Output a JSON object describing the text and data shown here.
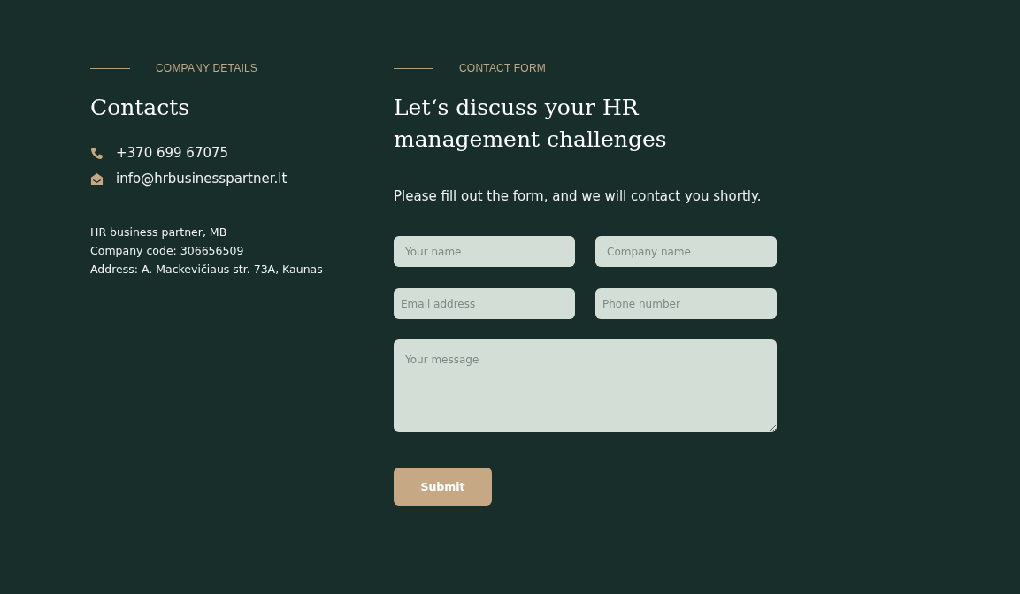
{
  "company": {
    "eyebrow": "COMPANY DETAILS",
    "title": "Contacts",
    "contacts": [
      {
        "kind": "phone",
        "text": "+370 699 67075"
      },
      {
        "kind": "email",
        "text": "info@hrbusinesspartner.lt"
      }
    ],
    "details": [
      "HR business partner, MB",
      "Company code: 306656509",
      "Address: A. Mackevičiaus str. 73A, Kaunas"
    ]
  },
  "form": {
    "eyebrow": "CONTACT FORM",
    "title": "Let‘s discuss your HR management challenges",
    "intro": "Please fill out the form, and we will contact you shortly.",
    "fields": [
      {
        "placeholder": "Your name"
      },
      {
        "placeholder": "Company name"
      },
      {
        "placeholder": "Email address"
      },
      {
        "placeholder": "Phone number"
      }
    ],
    "message": {
      "placeholder": "Your message"
    },
    "submit": "Submit"
  }
}
